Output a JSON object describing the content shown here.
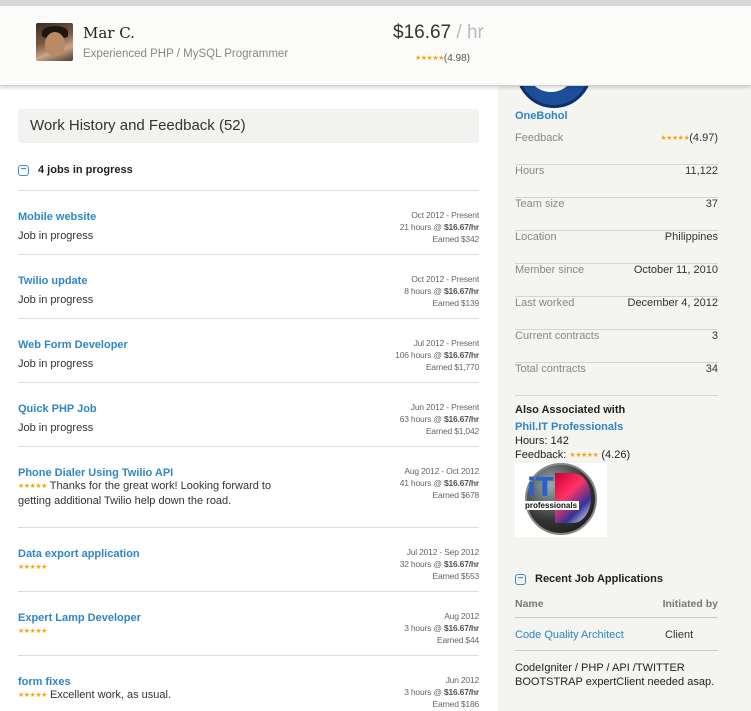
{
  "profile": {
    "name": "Mar C.",
    "title": "Experienced PHP / MySQL Programmer",
    "rate": "$16.67",
    "rate_unit": " / hr",
    "rating_stars": "★★★★★",
    "rating": "(4.98)"
  },
  "work_history": {
    "header": "Work History and Feedback (52)",
    "toggle_symbol": "−",
    "in_progress_label": "4 jobs in progress",
    "jobs": [
      {
        "title": "Mobile website",
        "desc": "Job in progress",
        "stars": "",
        "dates": "Oct 2012 - Present",
        "hours": "21 hours @ ",
        "rate": "$16.67/hr",
        "earned": "Earned $342"
      },
      {
        "title": "Twilio update",
        "desc": "Job in progress",
        "stars": "",
        "dates": "Oct 2012 - Present",
        "hours": "8 hours @ ",
        "rate": "$16.67/hr",
        "earned": "Earned $139"
      },
      {
        "title": "Web Form Developer",
        "desc": "Job in progress",
        "stars": "",
        "dates": "Jul 2012 - Present",
        "hours": "106 hours @ ",
        "rate": "$16.67/hr",
        "earned": "Earned $1,770"
      },
      {
        "title": "Quick PHP Job",
        "desc": "Job in progress",
        "stars": "",
        "dates": "Jun 2012 - Present",
        "hours": "63 hours @ ",
        "rate": "$16.67/hr",
        "earned": "Earned $1,042"
      },
      {
        "title": "Phone Dialer Using Twilio API",
        "desc": "Thanks for the great work! Looking forward to getting additional Twilio help down the road.",
        "stars": "★★★★★",
        "dates": "Aug 2012 - Oct 2012",
        "hours": "41 hours @ ",
        "rate": "$16.67/hr",
        "earned": "Earned $678"
      },
      {
        "title": "Data export application",
        "desc": "",
        "stars": "★★★★★",
        "dates": "Jul 2012 - Sep 2012",
        "hours": "32 hours @ ",
        "rate": "$16.67/hr",
        "earned": "Earned $553"
      },
      {
        "title": "Expert Lamp Developer",
        "desc": "",
        "stars": "★★★★★",
        "dates": "Aug 2012",
        "hours": "3 hours @ ",
        "rate": "$16.67/hr",
        "earned": "Earned $44"
      },
      {
        "title": "form fixes",
        "desc": "Excellent work, as usual.",
        "stars": "★★★★★",
        "dates": "Jun 2012",
        "hours": "3 hours @ ",
        "rate": "$16.67/hr",
        "earned": "Earned $186"
      }
    ]
  },
  "sidebar": {
    "org_name": "OneBohol",
    "stats": [
      {
        "label": "Feedback",
        "stars": "★★★★★",
        "value": "(4.97)"
      },
      {
        "label": "Hours",
        "stars": "",
        "value": "11,122"
      },
      {
        "label": "Team size",
        "stars": "",
        "value": "37"
      },
      {
        "label": "Location",
        "stars": "",
        "value": "Philippines"
      },
      {
        "label": "Member since",
        "stars": "",
        "value": "October 11, 2010"
      },
      {
        "label": "Last worked",
        "stars": "",
        "value": "December 4, 2012"
      },
      {
        "label": "Current contracts",
        "stars": "",
        "value": "3"
      },
      {
        "label": "Total contracts",
        "stars": "",
        "value": "34"
      }
    ],
    "associated": {
      "heading": "Also Associated with",
      "name": "Phil.IT Professionals",
      "hours": "Hours: 142",
      "feedback_label": "Feedback: ",
      "feedback_stars": "★★★★★",
      "feedback_value": "(4.26)",
      "logo_text_main": "iT",
      "logo_text_sub": "professionals"
    },
    "recent": {
      "toggle_symbol": "−",
      "heading": "Recent Job Applications",
      "col_name": "Name",
      "col_initiated": "Initiated by",
      "rows": [
        {
          "name": "Code Quality Architect",
          "initiated": "Client"
        }
      ],
      "desc": "CodeIgniter / PHP / API /TWITTER BOOTSTRAP expertClient needed asap."
    }
  },
  "colors": {
    "link": "#2f86c4",
    "star": "#f0a818",
    "sidebar_bg": "#f4f4f0"
  }
}
